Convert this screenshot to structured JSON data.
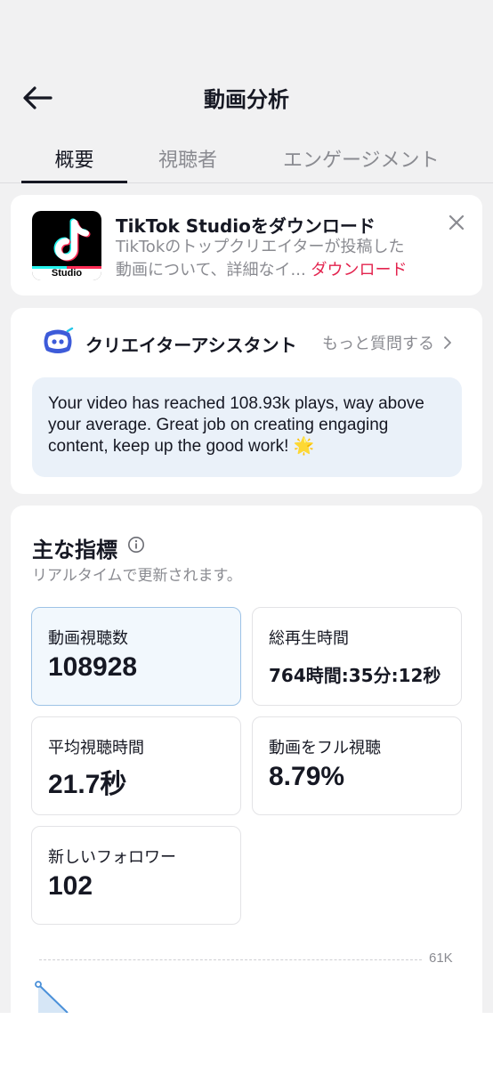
{
  "header": {
    "title": "動画分析",
    "back_icon": "arrow-left-icon"
  },
  "tabs": [
    {
      "label": "概要",
      "active": true
    },
    {
      "label": "視聴者",
      "active": false
    },
    {
      "label": "エンゲージメント",
      "active": false
    }
  ],
  "studio_banner": {
    "logo_text": "Studio",
    "title": "TikTok Studioをダウンロード",
    "description_line1": "TikTokのトップクリエイターが投稿した",
    "description_line2": "動画について、詳細なイ...",
    "link": "ダウンロード",
    "close_icon": "close-icon"
  },
  "assistant": {
    "title": "クリエイターアシスタント",
    "more_label": "もっと質問する",
    "message": "Your video has reached 108.93k plays, way above your average. Great job on creating engaging content, keep up the good work! 🌟"
  },
  "metrics": {
    "title": "主な指標",
    "subtitle": "リアルタイムで更新されます。",
    "items": [
      {
        "label": "動画視聴数",
        "value": "108928"
      },
      {
        "label": "総再生時間",
        "value": "764時間:35分:12秒"
      },
      {
        "label": "平均視聴時間",
        "value": "21.7秒"
      },
      {
        "label": "動画をフル視聴",
        "value": "8.79%"
      },
      {
        "label": "新しいフォロワー",
        "value": "102"
      }
    ],
    "chart_max_label": "61K"
  },
  "colors": {
    "accent_red": "#e3234e",
    "selected_tile_bg": "#f2f8fd",
    "assistant_bubble_bg": "#eaf1f9"
  }
}
